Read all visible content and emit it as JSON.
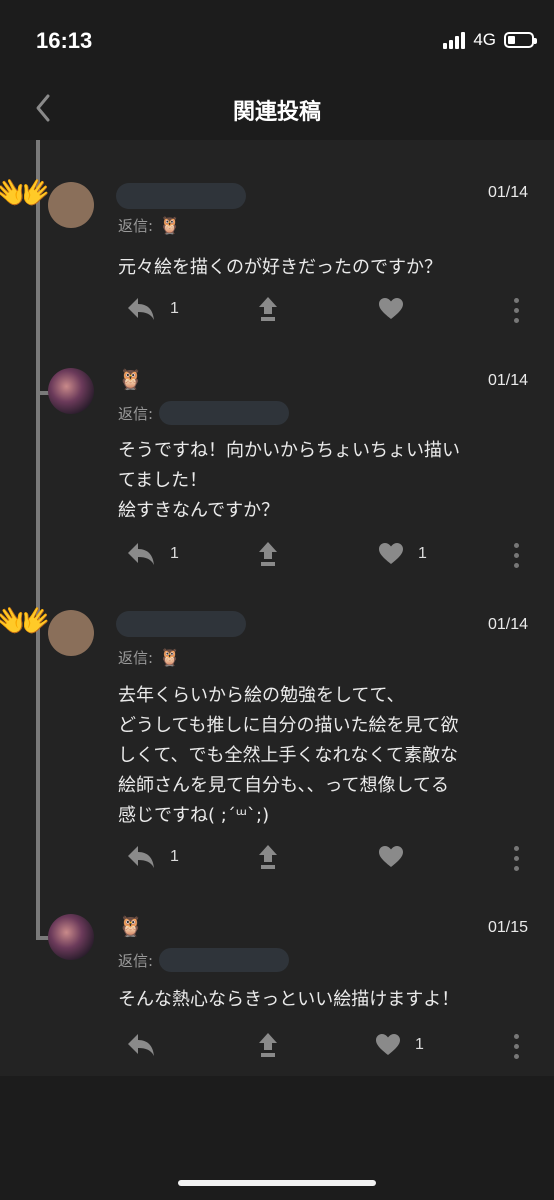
{
  "status": {
    "time": "16:13",
    "network": "4G",
    "battery_level": 0.3
  },
  "nav": {
    "title": "関連投稿"
  },
  "posts": [
    {
      "date": "01/14",
      "reply_label": "返信:",
      "reply_to_icon": "owl",
      "avatar": "hands-emoji",
      "text": "元々絵を描くのが好きだったのですか？",
      "reply_count": "1",
      "like_count": ""
    },
    {
      "date": "01/14",
      "reply_label": "返信:",
      "name_icon": "owl",
      "avatar": "image",
      "text": "そうですね！向かいからちょいちょい描い\nてました！\n絵すきなんですか？",
      "reply_count": "1",
      "like_count": "1"
    },
    {
      "date": "01/14",
      "reply_label": "返信:",
      "reply_to_icon": "owl",
      "avatar": "hands-emoji",
      "text": "去年くらいから絵の勉強をしてて、\nどうしても推しに自分の描いた絵を見て欲\nしくて、でも全然上手くなれなくて素敵な\n絵師さんを見て自分も、、って想像してる\n感じですね( ;´ᵚ`;)",
      "reply_count": "1",
      "like_count": ""
    },
    {
      "date": "01/15",
      "reply_label": "返信:",
      "name_icon": "owl",
      "avatar": "image",
      "text": "そんな熱心ならきっといい絵描けますよ！",
      "reply_count": "",
      "like_count": "1"
    }
  ],
  "colors": {
    "background": "#232323",
    "bar": "#1c1c1c",
    "thread_line": "#7a7a7a",
    "text": "#eaeaea"
  }
}
